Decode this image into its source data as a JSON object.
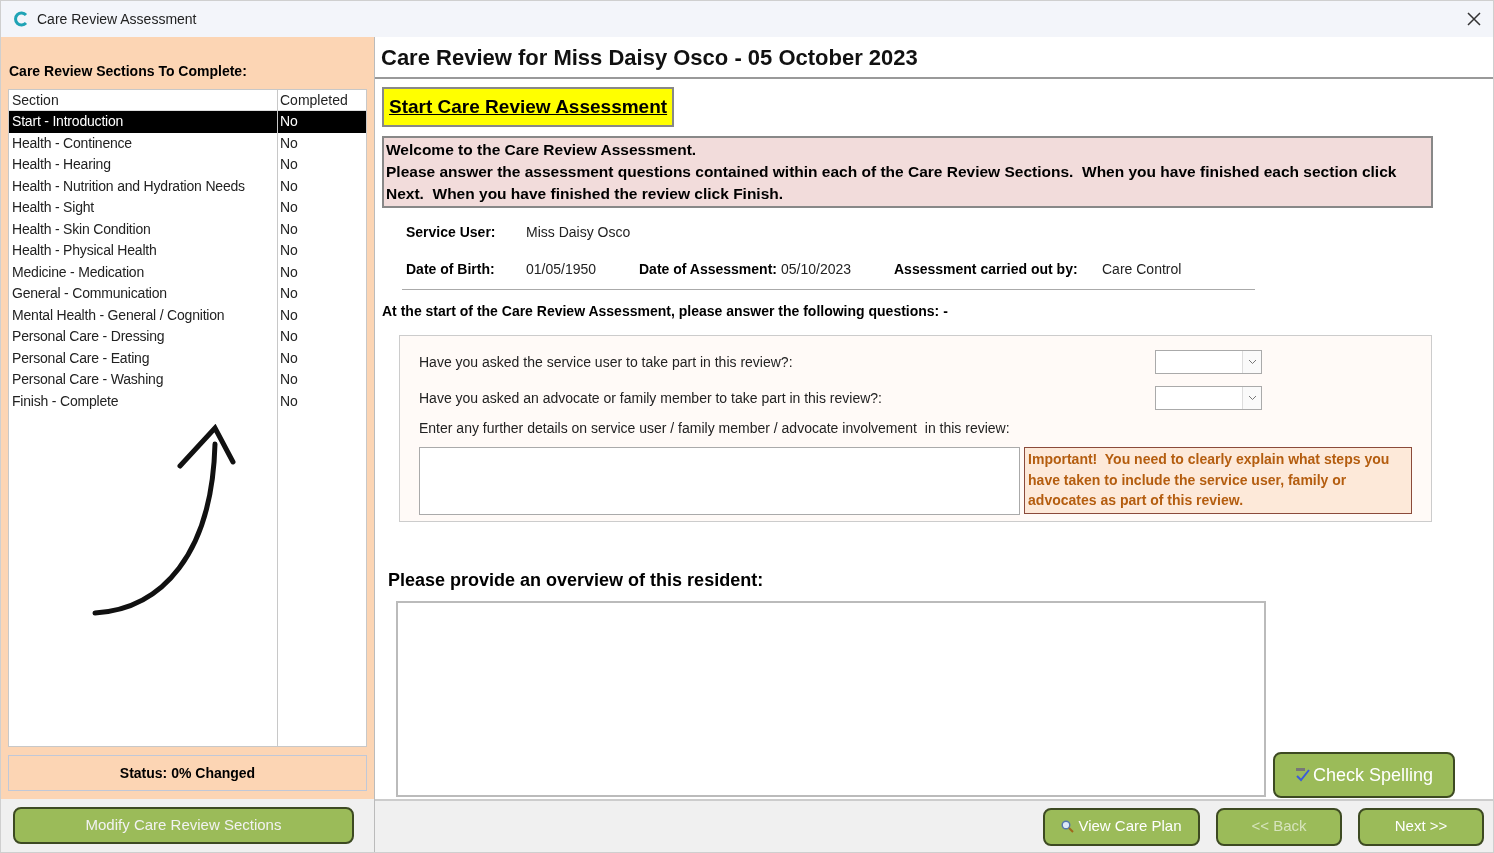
{
  "window": {
    "title": "Care Review Assessment"
  },
  "sidebar": {
    "heading": "Care Review Sections To Complete:",
    "columns": [
      "Section",
      "Completed"
    ],
    "rows": [
      {
        "section": "Start - Introduction",
        "completed": "No",
        "selected": true
      },
      {
        "section": "Health - Continence",
        "completed": "No",
        "selected": false
      },
      {
        "section": "Health - Hearing",
        "completed": "No",
        "selected": false
      },
      {
        "section": "Health - Nutrition and Hydration Needs",
        "completed": "No",
        "selected": false
      },
      {
        "section": "Health - Sight",
        "completed": "No",
        "selected": false
      },
      {
        "section": "Health - Skin Condition",
        "completed": "No",
        "selected": false
      },
      {
        "section": "Health - Physical Health",
        "completed": "No",
        "selected": false
      },
      {
        "section": "Medicine - Medication",
        "completed": "No",
        "selected": false
      },
      {
        "section": "General - Communication",
        "completed": "No",
        "selected": false
      },
      {
        "section": "Mental Health - General / Cognition",
        "completed": "No",
        "selected": false
      },
      {
        "section": "Personal Care - Dressing",
        "completed": "No",
        "selected": false
      },
      {
        "section": "Personal Care - Eating",
        "completed": "No",
        "selected": false
      },
      {
        "section": "Personal Care - Washing",
        "completed": "No",
        "selected": false
      },
      {
        "section": "Finish - Complete",
        "completed": "No",
        "selected": false
      }
    ],
    "status": "Status: 0% Changed",
    "button": "Modify Care Review Sections"
  },
  "main": {
    "title": "Care Review for Miss Daisy Osco - 05 October 2023",
    "start_link": "Start Care Review Assessment",
    "welcome": [
      "Welcome to the Care Review Assessment.",
      "Please answer the assessment questions contained within each of the Care Review Sections.  When you have finished each section click Next.  When you have finished the review click Finish."
    ],
    "details": [
      [
        {
          "label": "Service User:",
          "value": "Miss Daisy Osco"
        }
      ],
      [
        {
          "label": "Date of Birth:",
          "value": "01/05/1950"
        },
        {
          "label": "Date of Assessment:",
          "value": "05/10/2023"
        },
        {
          "label": "Assessment carried out by:",
          "value": "Care Control"
        }
      ]
    ],
    "intro": "At the start of the Care Review Assessment, please answer the following questions: -",
    "questions": [
      {
        "kind": "dropdown",
        "text": "Have you asked the service user to take part in this review?:"
      },
      {
        "kind": "dropdown",
        "text": "Have you asked an advocate or family member to take part in this review?:"
      },
      {
        "kind": "textarea",
        "text": "Enter any further details on service user / family member / advocate involvement  in this review:"
      }
    ],
    "important": "Important!  You need to clearly explain what steps you have taken to include the service user, family or advocates as part of this review.",
    "overview_label": "Please provide an overview of this resident:",
    "check_spelling": "Check Spelling"
  },
  "footer_buttons": [
    {
      "kind": "search",
      "label": "View Care Plan",
      "disabled": false
    },
    {
      "kind": "plain",
      "label": "<< Back",
      "disabled": true
    },
    {
      "kind": "plain",
      "label": "Next >>",
      "disabled": false
    }
  ]
}
